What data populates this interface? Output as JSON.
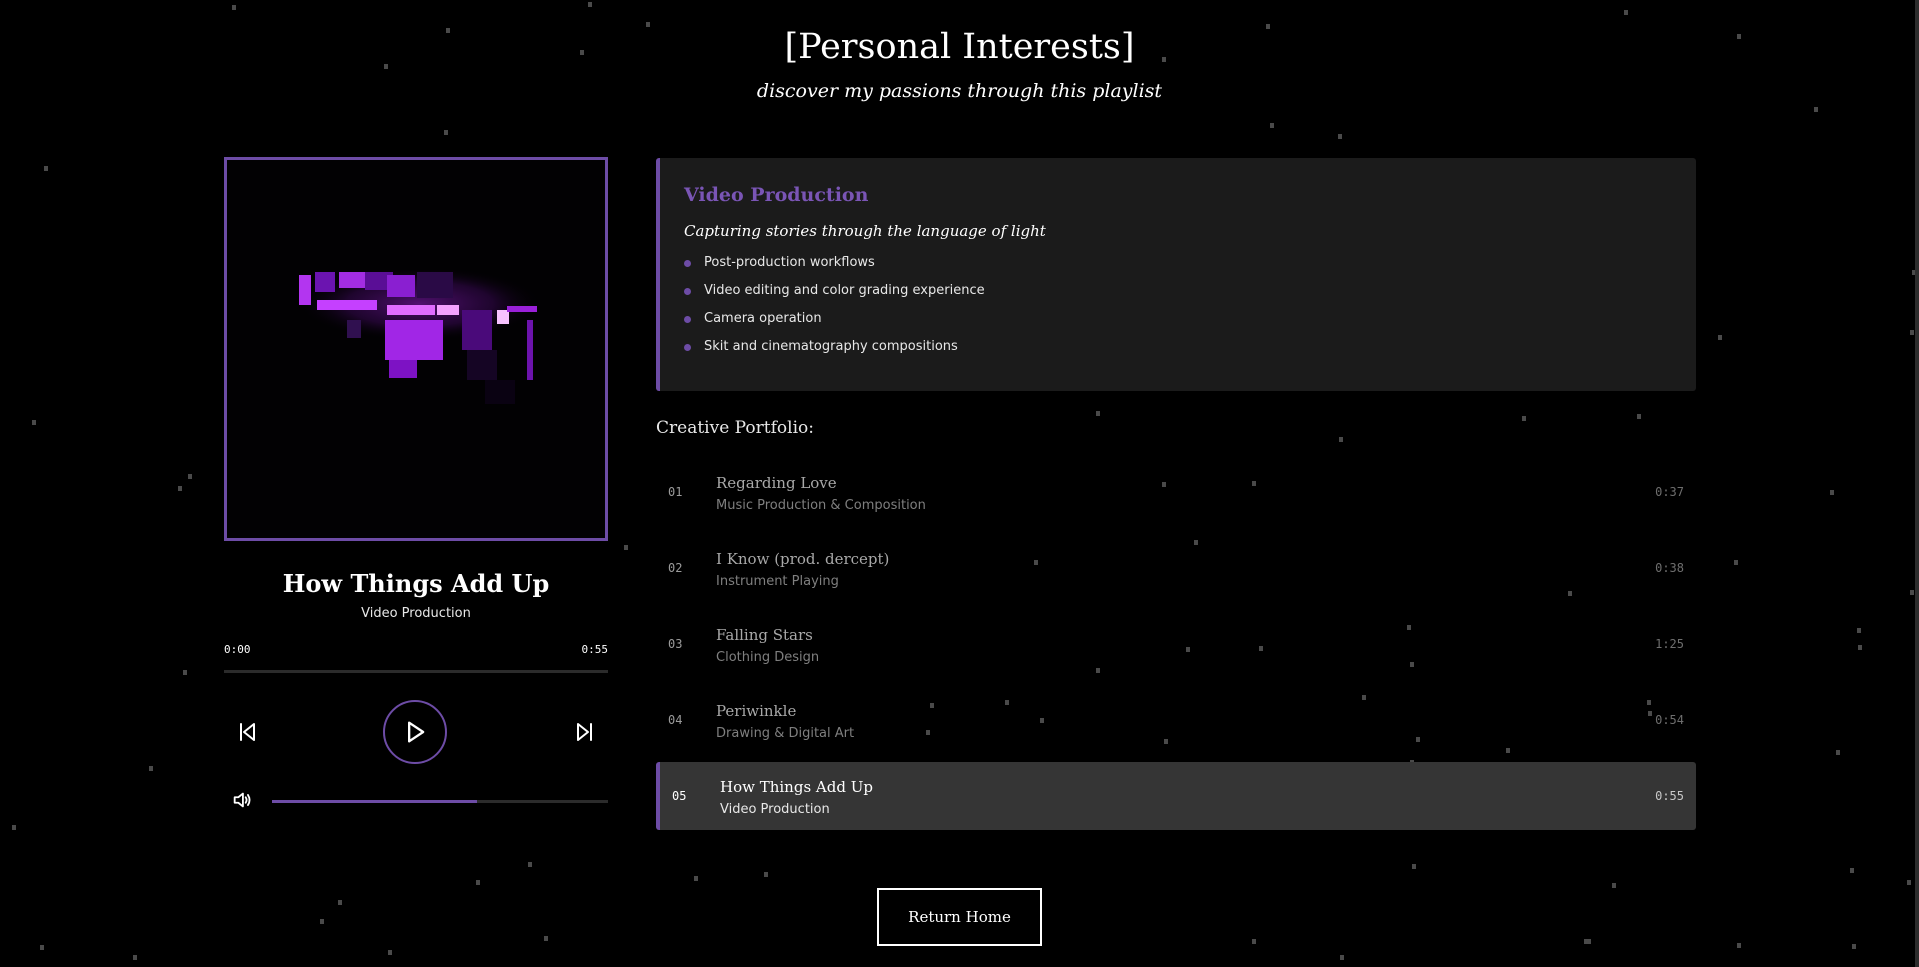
{
  "header": {
    "title": "[Personal Interests]",
    "subtitle": "discover my passions through this playlist"
  },
  "player": {
    "cover_icon": "artwork-image",
    "now_playing": {
      "title": "How Things Add Up",
      "category": "Video Production"
    },
    "time_current": "0:00",
    "time_total": "0:55",
    "progress_fraction": 0,
    "volume_fraction": 0.61,
    "icons": {
      "previous": "skip-previous-icon",
      "play": "play-icon",
      "next": "skip-next-icon",
      "volume": "volume-icon"
    },
    "accent_color": "#6d4ca6"
  },
  "detail": {
    "title": "Video Production",
    "tagline": "Capturing stories through the language of light",
    "bullets": [
      "Post-production workflows",
      "Video editing and color grading experience",
      "Camera operation",
      "Skit and cinematography compositions"
    ]
  },
  "portfolio": {
    "heading": "Creative Portfolio:",
    "tracks": [
      {
        "num": "01",
        "title": "Regarding Love",
        "subtitle": "Music Production & Composition",
        "duration": "0:37"
      },
      {
        "num": "02",
        "title": "I Know (prod. dercept)",
        "subtitle": "Instrument Playing",
        "duration": "0:38"
      },
      {
        "num": "03",
        "title": "Falling Stars",
        "subtitle": "Clothing Design",
        "duration": "1:25"
      },
      {
        "num": "04",
        "title": "Periwinkle",
        "subtitle": "Drawing & Digital Art",
        "duration": "0:54"
      },
      {
        "num": "05",
        "title": "How Things Add Up",
        "subtitle": "Video Production",
        "duration": "0:55",
        "active": true
      }
    ]
  },
  "footer": {
    "return_label": "Return Home"
  }
}
